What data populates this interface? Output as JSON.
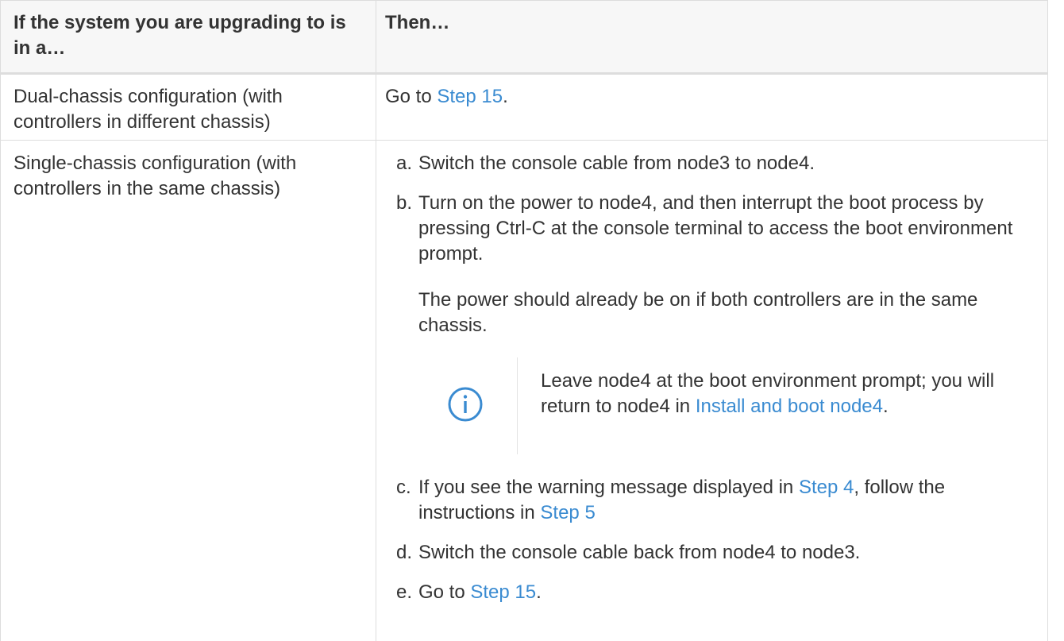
{
  "header": {
    "col1": "If the system you are upgrading to is in a…",
    "col2": "Then…"
  },
  "rows": [
    {
      "condition": "Dual-chassis configuration (with controllers in different chassis)",
      "action": {
        "before": "Go to ",
        "link": "Step 15",
        "after": "."
      }
    },
    {
      "condition": "Single-chassis configuration (with controllers in the same chassis)",
      "steps": [
        {
          "marker": "a.",
          "text": "Switch the console cable from node3 to node4."
        },
        {
          "marker": "b.",
          "text": "Turn on the power to node4, and then interrupt the boot process by pressing Ctrl-C at the console terminal to access the boot environment prompt.",
          "extra": "The power should already be on if both controllers are in the same chassis."
        },
        {
          "marker": "c.",
          "before": "If you see the warning message displayed in ",
          "link1": "Step 4",
          "mid": ", follow the instructions in ",
          "link2": "Step 5"
        },
        {
          "marker": "d.",
          "text": "Switch the console cable back from node4 to node3."
        },
        {
          "marker": "e.",
          "before": "Go to ",
          "link": "Step 15",
          "after": "."
        }
      ],
      "note": {
        "icon": "info-icon",
        "text": "Leave node4 at the boot environment prompt; you will return to node4 in ",
        "link": "Install and boot node4",
        "after": "."
      }
    }
  ],
  "colors": {
    "link": "#3a8bd1",
    "text": "#333333",
    "border": "#dddddd",
    "header_bg": "#f7f7f7"
  }
}
